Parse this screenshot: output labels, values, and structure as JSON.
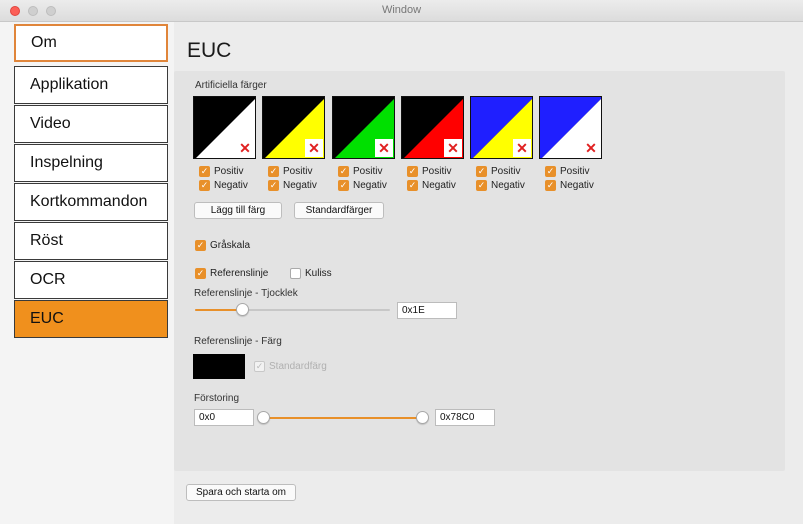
{
  "window": {
    "title": "Window"
  },
  "sidebar": {
    "items": [
      {
        "label": "Om"
      },
      {
        "label": "Applikation"
      },
      {
        "label": "Video"
      },
      {
        "label": "Inspelning"
      },
      {
        "label": "Kortkommandon"
      },
      {
        "label": "Röst"
      },
      {
        "label": "OCR"
      },
      {
        "label": "EUC"
      }
    ],
    "active_index": 7
  },
  "main": {
    "title": "EUC",
    "artificial_colors": {
      "label": "Artificiella färger",
      "remove_icon": "close-icon",
      "swatches": [
        {
          "top_left": "#000000",
          "bottom_right": "#ffffff",
          "positive": "Positiv",
          "negative": "Negativ",
          "positive_checked": true,
          "negative_checked": true
        },
        {
          "top_left": "#000000",
          "bottom_right": "#ffff00",
          "positive": "Positiv",
          "negative": "Negativ",
          "positive_checked": true,
          "negative_checked": true
        },
        {
          "top_left": "#000000",
          "bottom_right": "#00e000",
          "positive": "Positiv",
          "negative": "Negativ",
          "positive_checked": true,
          "negative_checked": true
        },
        {
          "top_left": "#000000",
          "bottom_right": "#ff0000",
          "positive": "Positiv",
          "negative": "Negativ",
          "positive_checked": true,
          "negative_checked": true
        },
        {
          "top_left": "#1f1fff",
          "bottom_right": "#ffff00",
          "positive": "Positiv",
          "negative": "Negativ",
          "positive_checked": true,
          "negative_checked": true
        },
        {
          "top_left": "#1f1fff",
          "bottom_right": "#ffffff",
          "positive": "Positiv",
          "negative": "Negativ",
          "positive_checked": true,
          "negative_checked": true
        }
      ],
      "add_button": "Lägg till färg",
      "default_button": "Standardfärger"
    },
    "grayscale": {
      "label": "Gråskala",
      "checked": true
    },
    "reference_line": {
      "label": "Referenslinje",
      "checked": true
    },
    "backdrop": {
      "label": "Kuliss",
      "checked": false
    },
    "thickness": {
      "label": "Referenslinje - Tjocklek",
      "value": "0x1E"
    },
    "line_color": {
      "label": "Referenslinje - Färg",
      "color": "#000000",
      "default_label": "Standardfärg",
      "default_checked": true,
      "default_disabled": true
    },
    "magnification": {
      "label": "Förstoring",
      "min_value": "0x0",
      "max_value": "0x78C0"
    },
    "save_restart": "Spara och starta om"
  },
  "colors": {
    "accent": "#f0901d",
    "panel": "#e3e3e3"
  }
}
